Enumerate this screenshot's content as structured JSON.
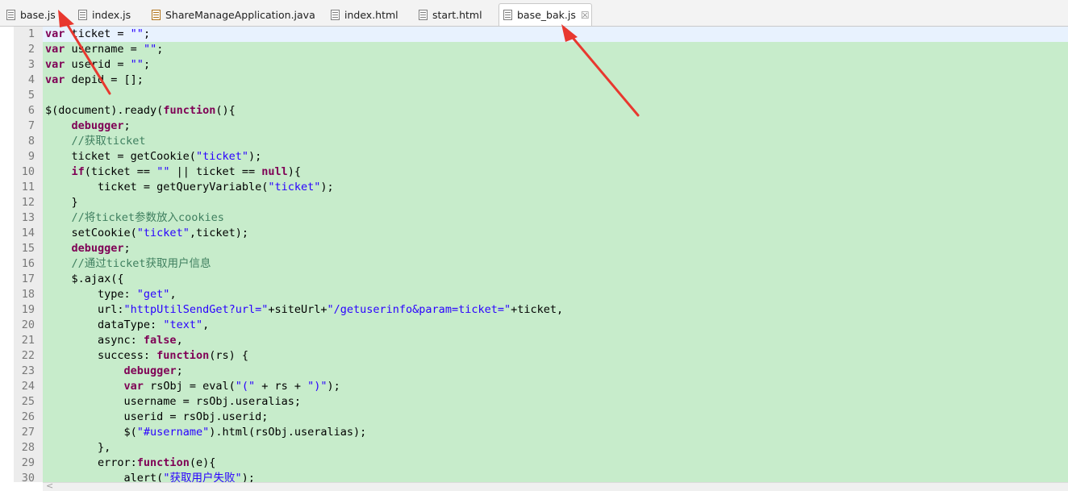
{
  "tabs": [
    {
      "label": "base.js",
      "icon": "js-file-icon",
      "active": false
    },
    {
      "label": "index.js",
      "icon": "js-file-icon",
      "active": false
    },
    {
      "label": "ShareManageApplication.java",
      "icon": "java-file-icon",
      "active": false
    },
    {
      "label": "index.html",
      "icon": "html-file-icon",
      "active": false
    },
    {
      "label": "start.html",
      "icon": "html-file-icon",
      "active": false
    },
    {
      "label": "base_bak.js",
      "icon": "js-file-icon",
      "active": true,
      "close": "☒"
    }
  ],
  "colors": {
    "keyword": "#7f0055",
    "string": "#2a00ff",
    "comment": "#3f7f5f",
    "diff_background": "#c7eccb",
    "gutter": "#ececec",
    "annotation_arrow": "#e8382f"
  },
  "editor": {
    "lines": [
      {
        "n": "1",
        "tokens": [
          [
            "kw",
            "var"
          ],
          [
            "t",
            " ticket = "
          ],
          [
            "str",
            "\"\""
          ],
          [
            "t",
            ";"
          ]
        ]
      },
      {
        "n": "2",
        "tokens": [
          [
            "kw",
            "var"
          ],
          [
            "t",
            " username = "
          ],
          [
            "str",
            "\"\""
          ],
          [
            "t",
            ";"
          ]
        ]
      },
      {
        "n": "3",
        "tokens": [
          [
            "kw",
            "var"
          ],
          [
            "t",
            " userid = "
          ],
          [
            "str",
            "\"\""
          ],
          [
            "t",
            ";"
          ]
        ]
      },
      {
        "n": "4",
        "tokens": [
          [
            "kw",
            "var"
          ],
          [
            "t",
            " depid = [];"
          ]
        ]
      },
      {
        "n": "5",
        "tokens": []
      },
      {
        "n": "6",
        "tokens": [
          [
            "t",
            "$(document).ready("
          ],
          [
            "kw",
            "function"
          ],
          [
            "t",
            "(){"
          ]
        ]
      },
      {
        "n": "7",
        "tokens": [
          [
            "t",
            "    "
          ],
          [
            "kw",
            "debugger"
          ],
          [
            "t",
            ";"
          ]
        ]
      },
      {
        "n": "8",
        "tokens": [
          [
            "t",
            "    "
          ],
          [
            "cm",
            "//获取ticket"
          ]
        ]
      },
      {
        "n": "9",
        "tokens": [
          [
            "t",
            "    ticket = getCookie("
          ],
          [
            "str",
            "\"ticket\""
          ],
          [
            "t",
            ");"
          ]
        ]
      },
      {
        "n": "10",
        "tokens": [
          [
            "t",
            "    "
          ],
          [
            "kw",
            "if"
          ],
          [
            "t",
            "(ticket == "
          ],
          [
            "str",
            "\"\""
          ],
          [
            "t",
            " || ticket == "
          ],
          [
            "kw",
            "null"
          ],
          [
            "t",
            "){"
          ]
        ]
      },
      {
        "n": "11",
        "tokens": [
          [
            "t",
            "        ticket = getQueryVariable("
          ],
          [
            "str",
            "\"ticket\""
          ],
          [
            "t",
            ");"
          ]
        ]
      },
      {
        "n": "12",
        "tokens": [
          [
            "t",
            "    }"
          ]
        ]
      },
      {
        "n": "13",
        "tokens": [
          [
            "t",
            "    "
          ],
          [
            "cm",
            "//将ticket参数放入cookies"
          ]
        ]
      },
      {
        "n": "14",
        "tokens": [
          [
            "t",
            "    setCookie("
          ],
          [
            "str",
            "\"ticket\""
          ],
          [
            "t",
            ",ticket);"
          ]
        ]
      },
      {
        "n": "15",
        "tokens": [
          [
            "t",
            "    "
          ],
          [
            "kw",
            "debugger"
          ],
          [
            "t",
            ";"
          ]
        ]
      },
      {
        "n": "16",
        "tokens": [
          [
            "t",
            "    "
          ],
          [
            "cm",
            "//通过ticket获取用户信息"
          ]
        ]
      },
      {
        "n": "17",
        "tokens": [
          [
            "t",
            "    $.ajax({"
          ]
        ]
      },
      {
        "n": "18",
        "tokens": [
          [
            "t",
            "        type: "
          ],
          [
            "str",
            "\"get\""
          ],
          [
            "t",
            ","
          ]
        ]
      },
      {
        "n": "19",
        "tokens": [
          [
            "t",
            "        url:"
          ],
          [
            "str",
            "\"httpUtilSendGet?url=\""
          ],
          [
            "t",
            "+siteUrl+"
          ],
          [
            "str",
            "\"/getuserinfo&param=ticket=\""
          ],
          [
            "t",
            "+ticket,"
          ]
        ]
      },
      {
        "n": "20",
        "tokens": [
          [
            "t",
            "        dataType: "
          ],
          [
            "str",
            "\"text\""
          ],
          [
            "t",
            ","
          ]
        ]
      },
      {
        "n": "21",
        "tokens": [
          [
            "t",
            "        async: "
          ],
          [
            "kw",
            "false"
          ],
          [
            "t",
            ","
          ]
        ]
      },
      {
        "n": "22",
        "tokens": [
          [
            "t",
            "        success: "
          ],
          [
            "kw",
            "function"
          ],
          [
            "t",
            "(rs) {"
          ]
        ]
      },
      {
        "n": "23",
        "tokens": [
          [
            "t",
            "            "
          ],
          [
            "kw",
            "debugger"
          ],
          [
            "t",
            ";"
          ]
        ]
      },
      {
        "n": "24",
        "tokens": [
          [
            "t",
            "            "
          ],
          [
            "kw",
            "var"
          ],
          [
            "t",
            " rsObj = eval("
          ],
          [
            "str",
            "\"(\""
          ],
          [
            "t",
            " + rs + "
          ],
          [
            "str",
            "\")\""
          ],
          [
            "t",
            ");"
          ]
        ]
      },
      {
        "n": "25",
        "tokens": [
          [
            "t",
            "            username = rsObj.useralias;"
          ]
        ]
      },
      {
        "n": "26",
        "tokens": [
          [
            "t",
            "            userid = rsObj.userid;"
          ]
        ]
      },
      {
        "n": "27",
        "tokens": [
          [
            "t",
            "            $("
          ],
          [
            "str",
            "\"#username\""
          ],
          [
            "t",
            ").html(rsObj.useralias);"
          ]
        ]
      },
      {
        "n": "28",
        "tokens": [
          [
            "t",
            "        },"
          ]
        ]
      },
      {
        "n": "29",
        "tokens": [
          [
            "t",
            "        error:"
          ],
          [
            "kw",
            "function"
          ],
          [
            "t",
            "(e){"
          ]
        ]
      },
      {
        "n": "30",
        "tokens": [
          [
            "t",
            "            alert("
          ],
          [
            "str",
            "\"获取用户失败\""
          ],
          [
            "t",
            ");"
          ]
        ]
      }
    ]
  },
  "scrollbar": {
    "left_arrow": "<"
  }
}
